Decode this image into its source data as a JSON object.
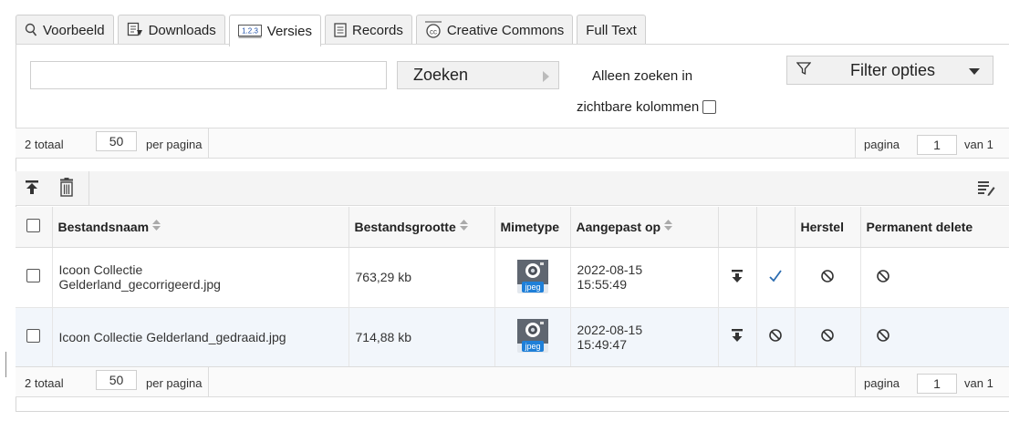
{
  "tabs": [
    {
      "label": "Voorbeeld",
      "icon": "magnifier-icon"
    },
    {
      "label": "Downloads",
      "icon": "downloads-icon"
    },
    {
      "label": "Versies",
      "icon": "version-badge-icon",
      "badge": "1.2.3",
      "active": true
    },
    {
      "label": "Records",
      "icon": "records-icon"
    },
    {
      "label": "Creative Commons",
      "icon": "creative-commons-icon"
    },
    {
      "label": "Full Text"
    }
  ],
  "search": {
    "value": "",
    "button_label": "Zoeken",
    "only_visible_label_1": "Alleen zoeken in",
    "only_visible_label_2": "zichtbare kolommen",
    "only_visible_checked": false,
    "filter_label": "Filter opties"
  },
  "pager_top": {
    "total": "2 totaal",
    "per_page": "50",
    "per_page_label": "per pagina",
    "page_label": "pagina",
    "page": "1",
    "of": "van 1"
  },
  "pager_bottom": {
    "total": "2 totaal",
    "per_page": "50",
    "per_page_label": "per pagina",
    "page_label": "pagina",
    "page": "1",
    "of": "van 1"
  },
  "table": {
    "columns": [
      "Bestandsnaam",
      "Bestandsgrootte",
      "Mimetype",
      "Aangepast op",
      "",
      "",
      "Herstel",
      "Permanent delete"
    ],
    "rows": [
      {
        "name_line1": "Icoon Collectie",
        "name_line2": "Gelderland_gecorrigeerd.jpg",
        "size": "763,29 kb",
        "mime": "jpeg",
        "modified_date": "2022-08-15",
        "modified_time": "15:55:49",
        "current": "check-icon"
      },
      {
        "name_line1": "Icoon Collectie Gelderland_gedraaid.jpg",
        "name_line2": "",
        "size": "714,88 kb",
        "mime": "jpeg",
        "modified_date": "2022-08-15",
        "modified_time": "15:49:47",
        "current": "prohibited-icon"
      }
    ]
  },
  "colors": {
    "accent": "#2b6cb0",
    "tab_bg": "#f1f1f1",
    "row_alt": "#f2f6fb",
    "mime_blue": "#1e7fd8"
  }
}
